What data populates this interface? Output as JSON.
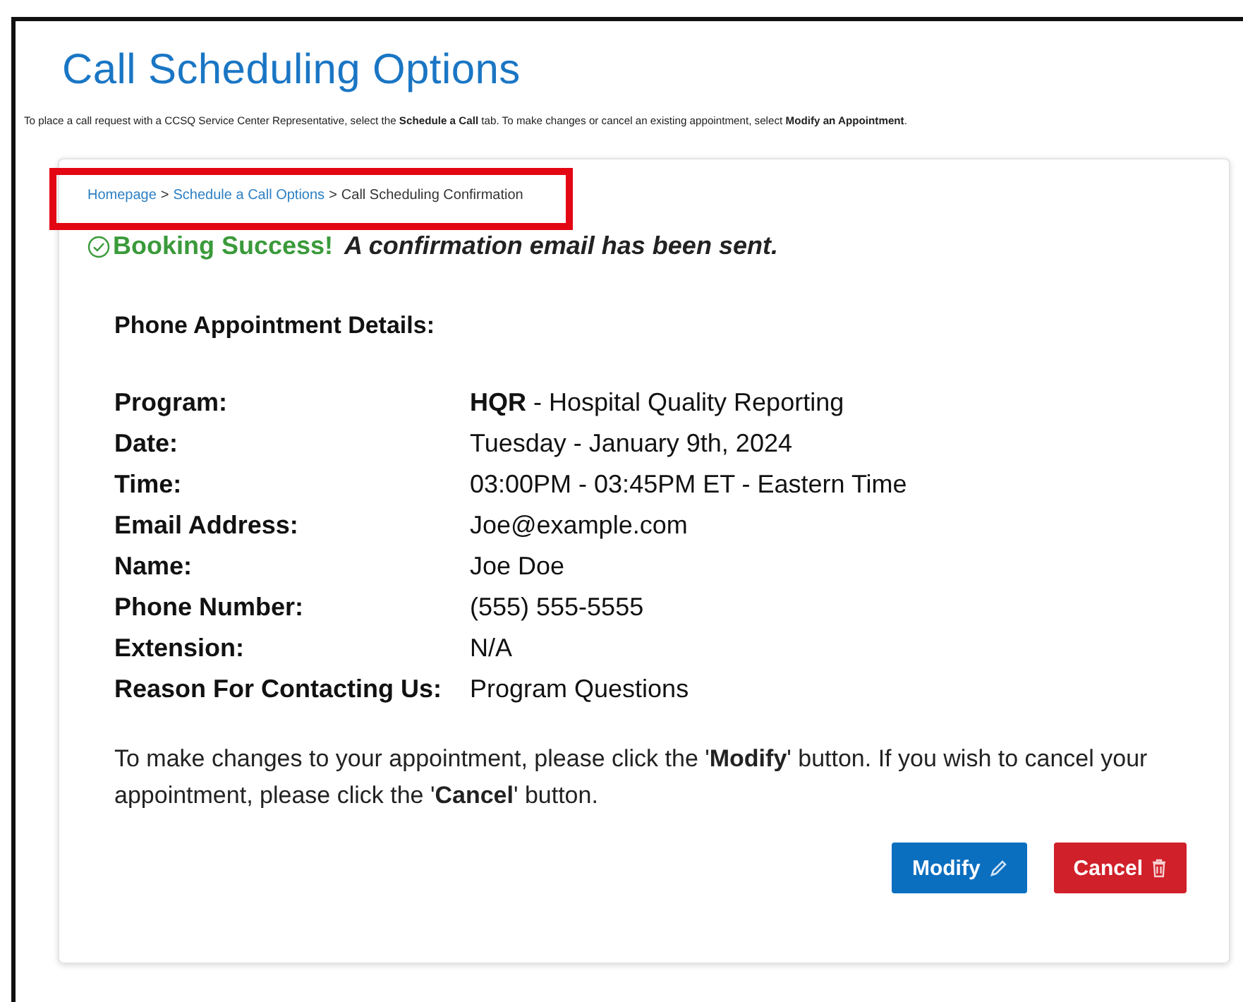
{
  "title": "Call Scheduling Options",
  "intro": "To place a call request with a CCSQ Service Center Representative, select the **Schedule a Call** tab. To make changes or cancel an existing appointment, select **Modify an Appointment**.",
  "breadcrumb": {
    "highlighted": true,
    "links": [
      "Homepage",
      "Schedule a Call Options"
    ],
    "separator": ">",
    "current": "Call Scheduling Confirmation"
  },
  "status": {
    "heading": "Booking Success!",
    "message": "A confirmation email has been sent."
  },
  "details_heading": "Phone Appointment Details:",
  "details": [
    {
      "label": "Program:",
      "value": "**HQR** - Hospital Quality Reporting"
    },
    {
      "label": "Date:",
      "value": "Tuesday - January 9th, 2024"
    },
    {
      "label": "Time:",
      "value": "03:00PM - 03:45PM ET - Eastern Time"
    },
    {
      "label": "Email Address:",
      "value": "Joe@example.com"
    },
    {
      "label": "Name:",
      "value": "Joe Doe"
    },
    {
      "label": "Phone Number:",
      "value": "(555) 555-5555"
    },
    {
      "label": "Extension:",
      "value": "N/A"
    },
    {
      "label": "Reason For Contacting Us:",
      "value": "Program Questions"
    }
  ],
  "note": "To make changes to your appointment, please click the '**Modify**' button. If you wish to cancel your appointment, please click the '**Cancel**' button.",
  "buttons": [
    {
      "label": "Modify",
      "kind": "modify"
    },
    {
      "label": "Cancel",
      "kind": "cancel"
    }
  ]
}
